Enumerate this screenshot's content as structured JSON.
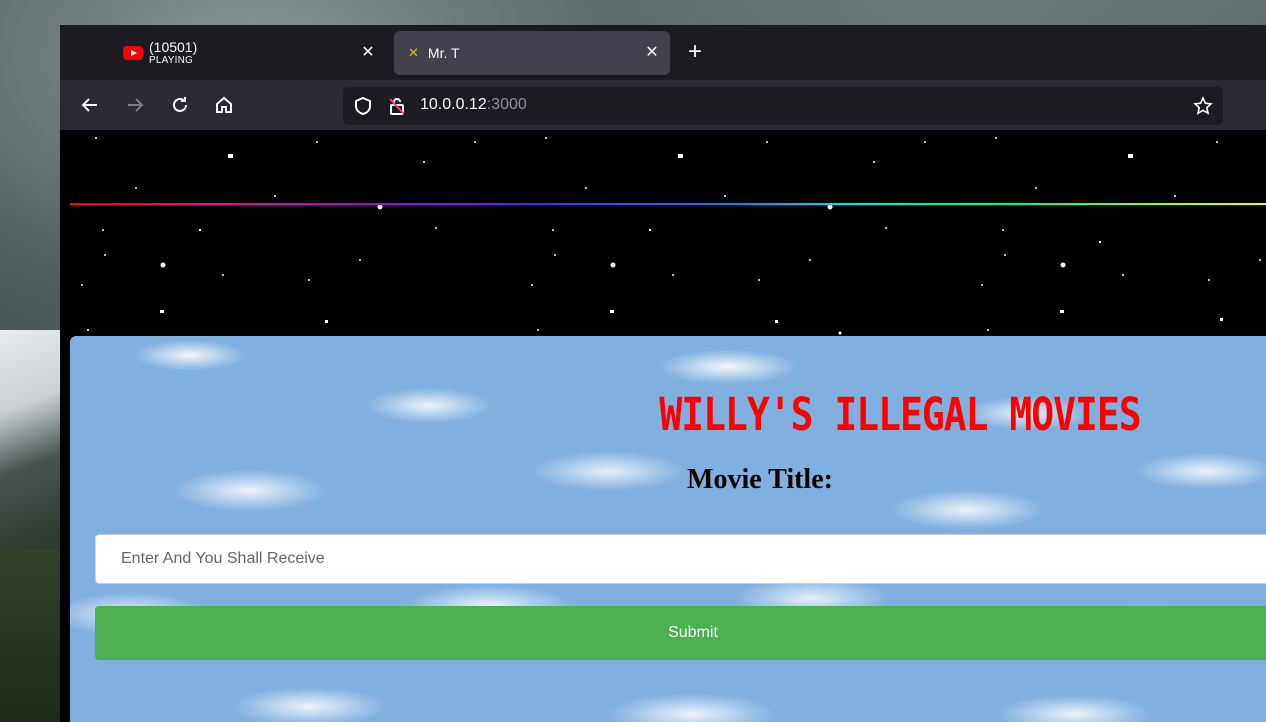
{
  "browser": {
    "tabs": [
      {
        "title": "(10501)",
        "subtitle": "PLAYING",
        "icon": "youtube-icon"
      },
      {
        "title": "Mr. T",
        "icon": "x-mark-icon"
      }
    ],
    "new_tab_icon": "plus-icon",
    "nav": {
      "back_icon": "back-arrow-icon",
      "forward_icon": "forward-arrow-icon",
      "reload_icon": "reload-icon",
      "home_icon": "home-icon"
    },
    "url": {
      "host": "10.0.0.12",
      "port": ":3000"
    }
  },
  "page": {
    "site_title": "WILLY'S ILLEGAL MOVIES",
    "movie_label": "Movie Title:",
    "search": {
      "placeholder": "Enter And You Shall Receive",
      "value": ""
    },
    "submit_label": "Submit"
  },
  "colors": {
    "title_red": "#ff0000",
    "submit_green": "#4caf50"
  }
}
